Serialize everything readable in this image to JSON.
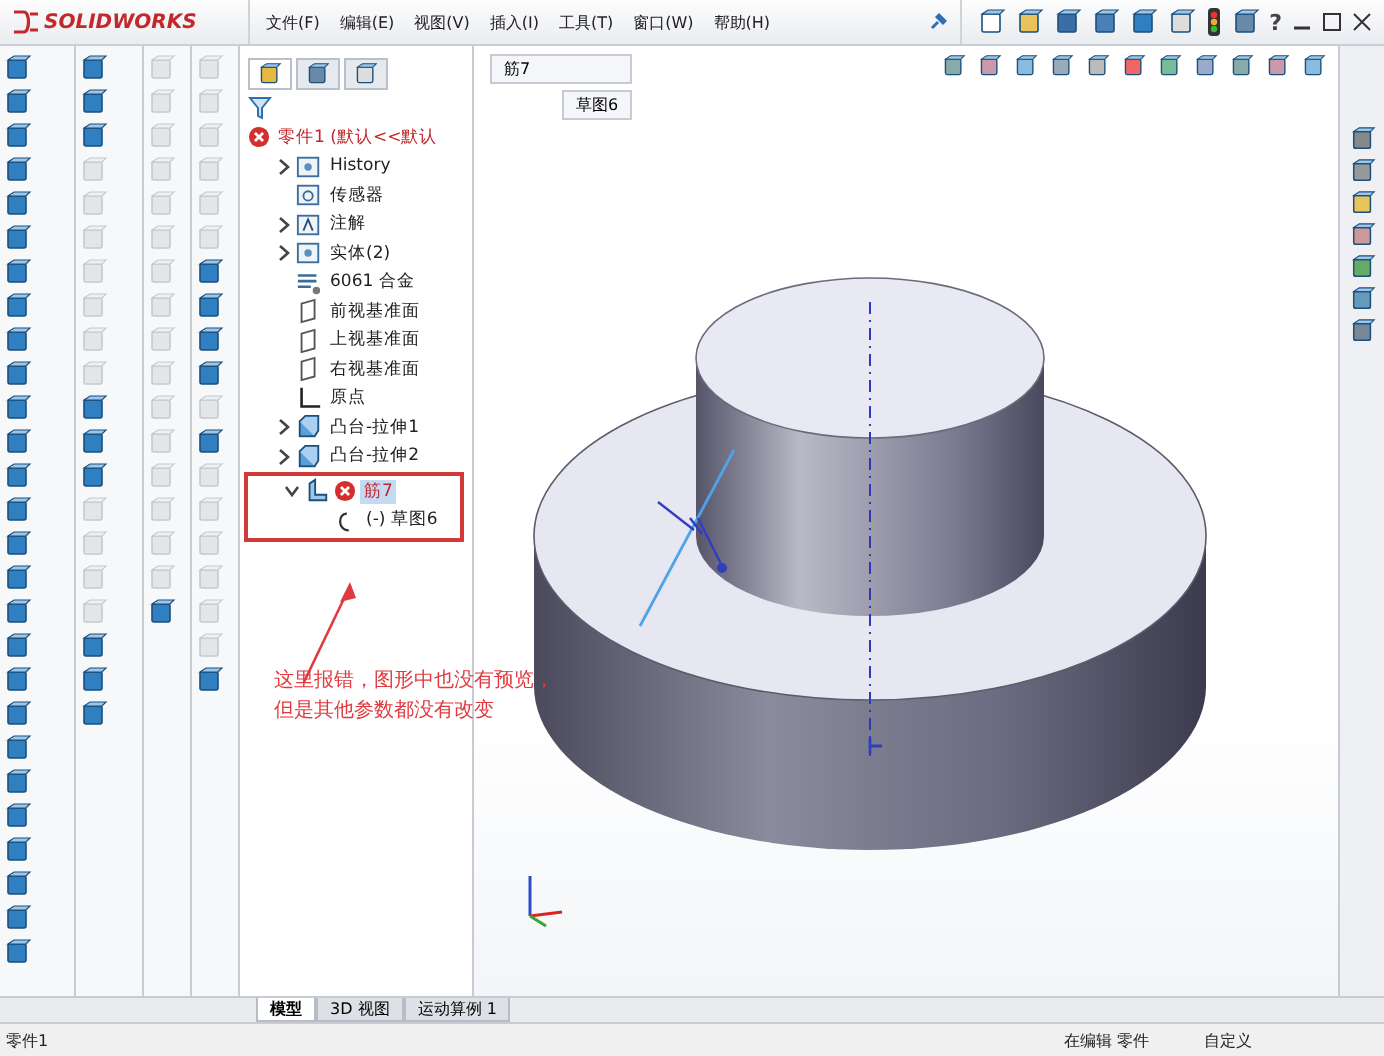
{
  "app": {
    "logo": "SOLIDWORKS",
    "menu": [
      "文件(F)",
      "编辑(E)",
      "视图(V)",
      "插入(I)",
      "工具(T)",
      "窗口(W)",
      "帮助(H)"
    ],
    "help": "?"
  },
  "feature_tree": {
    "root": {
      "label": "零件1",
      "config": "(默认<<默认",
      "error": true
    },
    "items": [
      {
        "label": "History",
        "kind": "folder",
        "expanded": false,
        "selected": false,
        "error": false
      },
      {
        "label": "传感器",
        "kind": "sensor",
        "selected": false,
        "error": false
      },
      {
        "label": "注解",
        "kind": "annotation",
        "expanded": false,
        "selected": false,
        "error": false
      },
      {
        "label": "实体(2)",
        "kind": "folder",
        "expanded": false,
        "selected": false,
        "error": false
      },
      {
        "label": "6061 合金",
        "kind": "material",
        "selected": false,
        "error": false
      },
      {
        "label": "前视基准面",
        "kind": "plane",
        "selected": false,
        "error": false
      },
      {
        "label": "上视基准面",
        "kind": "plane",
        "selected": false,
        "error": false
      },
      {
        "label": "右视基准面",
        "kind": "plane",
        "selected": false,
        "error": false
      },
      {
        "label": "原点",
        "kind": "origin",
        "selected": false,
        "error": false
      },
      {
        "label": "凸台-拉伸1",
        "kind": "extrude",
        "expanded": false,
        "selected": false,
        "error": false
      },
      {
        "label": "凸台-拉伸2",
        "kind": "extrude",
        "expanded": false,
        "selected": false,
        "error": false
      },
      {
        "label": "筋7",
        "kind": "rib",
        "expanded": true,
        "selected": true,
        "error": true,
        "children": [
          {
            "label": "(-) 草图6",
            "kind": "sketch",
            "selected": false,
            "error": false
          }
        ]
      }
    ]
  },
  "annotation": {
    "lines": [
      "这里报错，图形中也没有预览，",
      "但是其他参数都没有改变"
    ]
  },
  "breadcrumb": [
    "筋7",
    "草图6"
  ],
  "bottom_tabs": [
    {
      "label": "模型",
      "selected": true
    },
    {
      "label": "3D 视图",
      "selected": false
    },
    {
      "label": "运动算例 1",
      "selected": false
    }
  ],
  "status_bar": {
    "document": "零件1",
    "mode": "在编辑 零件",
    "units": "自定义"
  }
}
